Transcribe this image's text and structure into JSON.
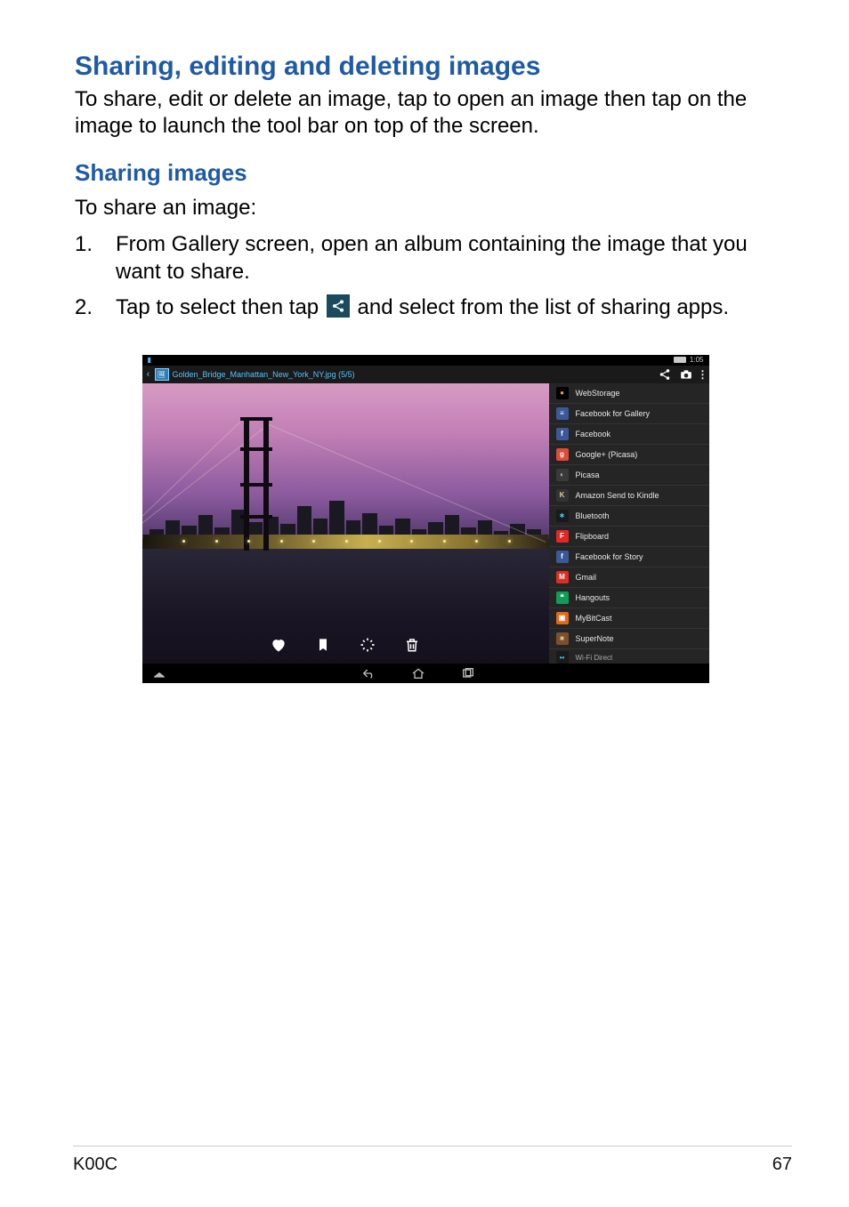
{
  "headings": {
    "h1": "Sharing, editing and deleting images",
    "h1_body": "To share, edit or delete an image, tap to open an image then tap on the image to launch the tool bar on top of the screen.",
    "h2": "Sharing images",
    "h2_intro": "To share an image:"
  },
  "steps": {
    "s1": "From Gallery screen, open an album containing the image that you want to share.",
    "s2a": "Tap to select then tap ",
    "s2b": " and select from the list of sharing apps."
  },
  "screenshot": {
    "status_time": "1:05",
    "title_filename": "Golden_Bridge_Manhattan_New_York_NY.jpg (5/5)",
    "share_apps": [
      {
        "label": "WebStorage",
        "bg": "#000000",
        "glyph": "●",
        "gcolor": "#ff9a2e"
      },
      {
        "label": "Facebook for Gallery",
        "bg": "#3b5998",
        "glyph": "≡",
        "gcolor": "#ffffff"
      },
      {
        "label": "Facebook",
        "bg": "#3b5998",
        "glyph": "f",
        "gcolor": "#ffffff"
      },
      {
        "label": "Google+ (Picasa)",
        "bg": "#dd4b39",
        "glyph": "g",
        "gcolor": "#ffffff"
      },
      {
        "label": "Picasa",
        "bg": "#3a3a3a",
        "glyph": "◐",
        "gcolor": "#c0c0c0"
      },
      {
        "label": "Amazon Send to Kindle",
        "bg": "#333333",
        "glyph": "K",
        "gcolor": "#d8c9a8"
      },
      {
        "label": "Bluetooth",
        "bg": "#1a1a1a",
        "glyph": "∗",
        "gcolor": "#4bc3ff"
      },
      {
        "label": "Flipboard",
        "bg": "#e12828",
        "glyph": "F",
        "gcolor": "#ffffff"
      },
      {
        "label": "Facebook for Story",
        "bg": "#3b5998",
        "glyph": "f",
        "gcolor": "#ffffff"
      },
      {
        "label": "Gmail",
        "bg": "#d93025",
        "glyph": "M",
        "gcolor": "#ffffff"
      },
      {
        "label": "Hangouts",
        "bg": "#0f9d58",
        "glyph": "❝",
        "gcolor": "#ffffff"
      },
      {
        "label": "MyBitCast",
        "bg": "#e06a1a",
        "glyph": "▣",
        "gcolor": "#ffffff"
      },
      {
        "label": "SuperNote",
        "bg": "#7a5030",
        "glyph": "■",
        "gcolor": "#e0c080"
      },
      {
        "label": "Wi-Fi Direct",
        "bg": "#1a1a1a",
        "glyph": "••",
        "gcolor": "#4bc3ff"
      }
    ]
  },
  "footer": {
    "model": "K00C",
    "page": "67"
  }
}
